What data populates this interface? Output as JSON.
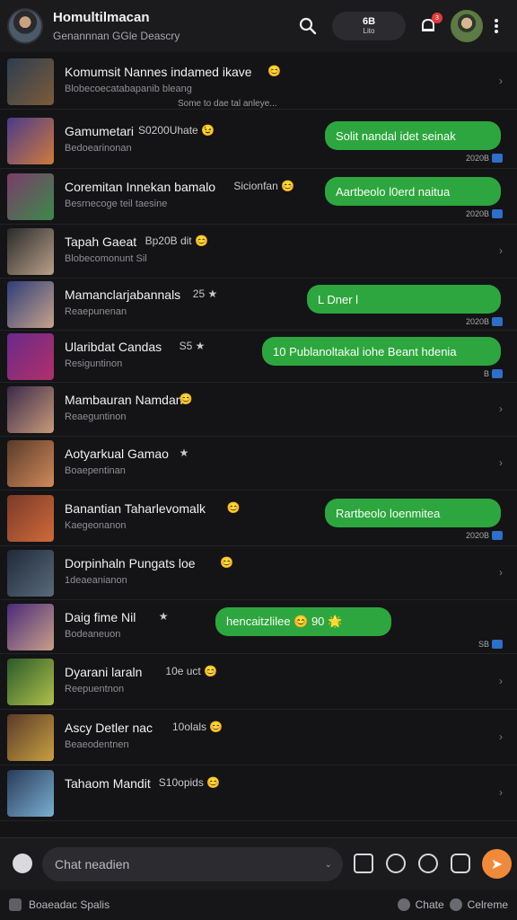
{
  "header": {
    "title": "Homultilmacan",
    "subtitle": "Genannnan GGle Deascry",
    "pill_top": "6B",
    "pill_bottom": "Lito",
    "notification_count": "3"
  },
  "chats": [
    {
      "name": "Komumsit Nannes indamed ikave",
      "emoji": "😊",
      "sub": "Blobecoecatabapanib bleang",
      "preview": "Some to dae tal anleye...",
      "thumb": [
        "#2c3e50",
        "#7d5b3a"
      ]
    },
    {
      "name": "Gamumetari",
      "extra": "S0200Uhate",
      "emoji": "😉",
      "sub": "Bedoearinonan",
      "bubble": "Solit nandal idet seinak",
      "time": "2020B",
      "thumb": [
        "#4b3b8a",
        "#d07a3a"
      ]
    },
    {
      "name": "Coremitan Innekan bamalo",
      "extra": "Sicionfan",
      "emoji": "😊",
      "sub": "Besrnecoge teil taesine",
      "bubble": "Aartbeolo l0erd naitua",
      "time": "2020B",
      "thumb": [
        "#7a3c6b",
        "#3c8a4a"
      ]
    },
    {
      "name": "Tapah Gaeat",
      "extra": "Bp20B dit",
      "emoji": "😊",
      "sub": "Blobecomonunt Sil",
      "thumb": [
        "#2a2a2a",
        "#b9a08a"
      ]
    },
    {
      "name": "Mamanclarjabannals",
      "extra": "25 ★",
      "sub": "Reaepunenan",
      "bubble": "L Dner l",
      "time": "2020B",
      "thumb": [
        "#2f3c7a",
        "#c7a38a"
      ]
    },
    {
      "name": "Ularibdat Candas",
      "extra": "S5 ★",
      "sub": "Resiguntinon",
      "bubble": "10 Publanoltakal iohe Beant hdenia",
      "time": "B",
      "thumb": [
        "#6a2a8a",
        "#b0306a"
      ]
    },
    {
      "name": "Mambauran Namdan",
      "emoji": "😊",
      "sub": "Reaeguntinon",
      "thumb": [
        "#3a2a4a",
        "#c89a7a"
      ]
    },
    {
      "name": "Aotyarkual Gamao",
      "extra": "★",
      "sub": "Boaepentinan",
      "thumb": [
        "#5a3a2a",
        "#d08a5a"
      ]
    },
    {
      "name": "Banantian Taharlevomalk",
      "emoji": "😊",
      "sub": "Kaegeonanon",
      "bubble": "Rartbeolo loenmitea",
      "time": "2020B",
      "thumb": [
        "#7a3a2a",
        "#d06a3a"
      ]
    },
    {
      "name": "Dorpinhaln Pungats loe",
      "emoji": "😊",
      "sub": "1deaeanianon",
      "thumb": [
        "#1f2a3a",
        "#5a6a7a"
      ]
    },
    {
      "name": "Daig fime Nil",
      "extra": "★",
      "sub": "Bodeaneuon",
      "bubble": "hencaitzlilee 😊 90 🌟",
      "time": "SB",
      "thumb": [
        "#4a2a7a",
        "#c8a08a"
      ]
    },
    {
      "name": "Dyarani laraln",
      "extra": "10e uct",
      "emoji": "😊",
      "sub": "Reepuentnon",
      "thumb": [
        "#2a5a2a",
        "#b0c04a"
      ]
    },
    {
      "name": "Ascy Detler nac",
      "extra": "10olals",
      "emoji": "😊",
      "sub": "Beaeodentnen",
      "thumb": [
        "#5a3a2a",
        "#c8a040"
      ]
    },
    {
      "name": "Tahaom Mandit",
      "extra": "S10opids",
      "emoji": "😊",
      "sub": "",
      "thumb": [
        "#2a3a5a",
        "#7ab0d0"
      ]
    }
  ],
  "composer": {
    "placeholder": "Chat neadien"
  },
  "footer": {
    "left": "Boaeadac Spalis",
    "right_a": "Chate",
    "right_b": "Celreme"
  }
}
